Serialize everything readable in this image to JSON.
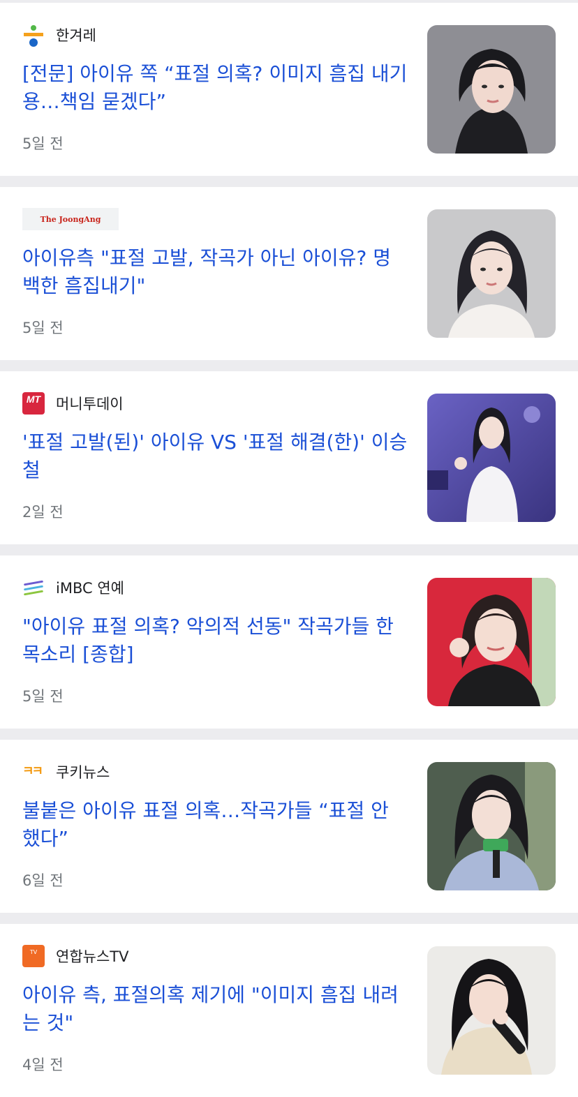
{
  "articles": [
    {
      "source": "한겨레",
      "logo": "hankyoreh-logo",
      "title": "[전문] 아이유 쪽 “표절 의혹? 이미지 흠집 내기용…책임 묻겠다”",
      "time": "5일 전",
      "thumb_bg": "#8d8d92"
    },
    {
      "source": "",
      "logo_text": "The JoongAng",
      "logo": "joongang-logo",
      "title": "아이유측 \"표절 고발, 작곡가 아닌 아이유? 명백한 흠집내기\"",
      "time": "5일 전",
      "thumb_bg": "#c9c9cb"
    },
    {
      "source": "머니투데이",
      "logo": "moneytoday-logo",
      "logo_text": "MT",
      "title": "'표절 고발(된)' 아이유 VS '표절 해결(한)' 이승철",
      "time": "2일 전",
      "thumb_bg": "#5b4fa8"
    },
    {
      "source": "iMBC 연예",
      "logo": "imbc-logo",
      "title": "\"아이유 표절 의혹? 악의적 선동\" 작곡가들 한 목소리 [종합]",
      "time": "5일 전",
      "thumb_bg": "#d8283c"
    },
    {
      "source": "쿠키뉴스",
      "logo": "kukinews-logo",
      "logo_text": "ㅋㅋ",
      "title": "불붙은 아이유 표절 의혹…작곡가들 “표절 안 했다”",
      "time": "6일 전",
      "thumb_bg": "#5a6b5a"
    },
    {
      "source": "연합뉴스TV",
      "logo": "yonhapnewstv-logo",
      "logo_text": "TV",
      "title": "아이유 측, 표절의혹 제기에 \"이미지 흠집 내려는 것\"",
      "time": "4일 전",
      "thumb_bg": "#ecebe8"
    }
  ]
}
